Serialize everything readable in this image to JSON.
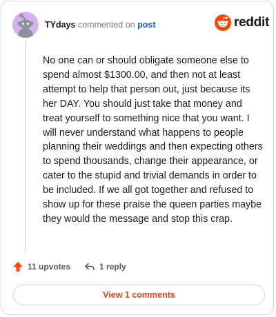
{
  "comment": {
    "username": "TYdays",
    "action_text": "commented on",
    "post_link": "post",
    "body": "No one can or should obligate someone else to spend almost $1300.00, and then not at least attempt to help that person out, just because its her DAY. You should just take that money and treat yourself to something nice that you want. I will never understand what happens to people planning their weddings and then expecting others to spend thousands, change their appearance, or cater to the stupid and trivial demands in order to be included. If we all got together and refused to show up for these praise the queen parties maybe they would the message and stop this crap."
  },
  "brand": {
    "name": "reddit",
    "color": "#ff4500"
  },
  "actions": {
    "upvotes_label": "11 upvotes",
    "reply_label": "1 reply",
    "upvote_color": "#ff4500"
  },
  "footer": {
    "view_comments_label": "View 1 comments",
    "view_comments_color": "#e2431d"
  },
  "avatar": {
    "background": "#d4b1f0"
  }
}
